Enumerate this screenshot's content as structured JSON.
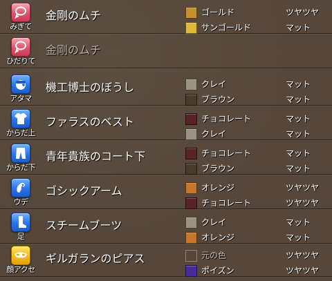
{
  "rows": [
    {
      "slot_label": "みぎて",
      "icon": "whip-icon",
      "icon_color": "#e0526c",
      "item_name": "金剛のムチ",
      "dimmed": false,
      "dyes": [
        {
          "color_name": "ゴールド",
          "swatch": "#c6912d",
          "finish": "ツヤツヤ"
        },
        {
          "color_name": "サンゴールド",
          "swatch": "#e0b93a",
          "finish": "マット"
        }
      ]
    },
    {
      "slot_label": "ひだりて",
      "icon": "whip-icon",
      "icon_color": "#e0526c",
      "item_name": "金剛のムチ",
      "dimmed": true,
      "dyes": []
    },
    {
      "slot_label": "アタマ",
      "icon": "hat-icon",
      "icon_color": "#2a74e8",
      "item_name": "機工博士のぼうし",
      "dimmed": false,
      "dyes": [
        {
          "color_name": "クレイ",
          "swatch": "#9c9282",
          "finish": "マット"
        },
        {
          "color_name": "ブラウン",
          "swatch": "#4a3a2a",
          "finish": "マット"
        }
      ]
    },
    {
      "slot_label": "からだ上",
      "icon": "shirt-icon",
      "icon_color": "#2a74e8",
      "item_name": "ファラスのベスト",
      "dimmed": false,
      "dyes": [
        {
          "color_name": "チョコレート",
          "swatch": "#5a2323",
          "finish": "マット"
        },
        {
          "color_name": "クレイ",
          "swatch": "#9c9282",
          "finish": "マット"
        }
      ]
    },
    {
      "slot_label": "からだ下",
      "icon": "pants-icon",
      "icon_color": "#2a74e8",
      "item_name": "青年貴族のコート下",
      "dimmed": false,
      "dyes": [
        {
          "color_name": "チョコレート",
          "swatch": "#5a2323",
          "finish": "マット"
        },
        {
          "color_name": "ブラウン",
          "swatch": "#4a3a2a",
          "finish": "マット"
        }
      ]
    },
    {
      "slot_label": "ウデ",
      "icon": "gauntlet-icon",
      "icon_color": "#2a74e8",
      "item_name": "ゴシックアーム",
      "dimmed": false,
      "dyes": [
        {
          "color_name": "オレンジ",
          "swatch": "#c8742a",
          "finish": "ツヤツヤ"
        },
        {
          "color_name": "チョコレート",
          "swatch": "#5a2323",
          "finish": "ツヤツヤ"
        }
      ]
    },
    {
      "slot_label": "足",
      "icon": "boot-icon",
      "icon_color": "#2a74e8",
      "item_name": "スチームブーツ",
      "dimmed": false,
      "dyes": [
        {
          "color_name": "クレイ",
          "swatch": "#9c9282",
          "finish": "マット"
        },
        {
          "color_name": "オレンジ",
          "swatch": "#c8742a",
          "finish": "マット"
        }
      ]
    },
    {
      "slot_label": "顔アクセ",
      "icon": "mask-icon",
      "icon_color": "#f6bb1e",
      "item_name": "ギルガランのピアス",
      "dimmed": false,
      "dyes": [
        {
          "color_name": "元の色",
          "swatch": "",
          "finish": "ツヤツヤ"
        },
        {
          "color_name": "ポイズン",
          "swatch": "#4b2aa0",
          "finish": "ツヤツヤ"
        }
      ]
    }
  ]
}
